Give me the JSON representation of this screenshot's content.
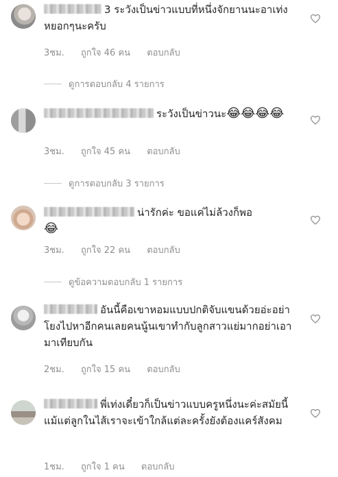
{
  "comments": [
    {
      "text": "3 ระวังเป็นข่าวแบบที่หนึ่งจักยานนะอาเท่ง หยอกๆนะครับ",
      "time": "3ชม.",
      "likes": "ถูกใจ 46 คน",
      "reply": "ตอบกลับ",
      "view_replies": "ดูการตอบกลับ 4 รายการ"
    },
    {
      "text": "ระวังเป็นข่าวนะ",
      "emoji": "😂😂😂😂",
      "time": "3ชม.",
      "likes": "ถูกใจ 45 คน",
      "reply": "ตอบกลับ",
      "view_replies": "ดูการตอบกลับ 3 รายการ"
    },
    {
      "text": "น่ารักค่ะ ขอแค่ไม่ล้วงก็พอ",
      "emoji": "😂",
      "time": "3ชม.",
      "likes": "ถูกใจ 22 คน",
      "reply": "ตอบกลับ",
      "view_replies": "ดูข้อความตอบกลับ 1 รายการ"
    },
    {
      "text": "อันนี้คือเขาหอมแบบปกติจับแขนด้วยอ่ะอย่าโยงไปหาอีกคนเลยคนนู้นเขาทำกับลูกสาวแย่มากอย่าเอามาเทียบกัน",
      "time": "2ชม.",
      "likes": "ถูกใจ 15 คน",
      "reply": "ตอบกลับ"
    },
    {
      "text": "พี่เท่งเดี๋ยวก็เป็นข่าวแบบครูหนึ่งนะค่ะสมัยนี้แม้แต่ลูกในไส้เราจะเข้าใกล้แต่ละครั้งยังต้องแคร์สังคม",
      "time": "1ชม.",
      "likes": "ถูกใจ 1 คน",
      "reply": "ตอบกลับ"
    }
  ],
  "icons": {
    "heart": "heart-outline-icon"
  },
  "colors": {
    "text": "#262626",
    "meta": "#8e8e8e",
    "background": "#ffffff"
  }
}
